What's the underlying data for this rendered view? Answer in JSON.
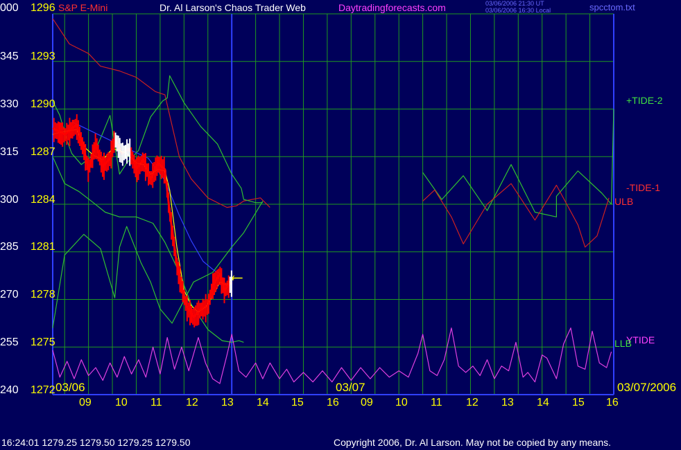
{
  "header": {
    "symbol": "S&P E-Mini",
    "title": "Dr. Al Larson's Chaos Trader Web",
    "site": "Daytradingforecasts.com",
    "timestamp_ut": "03/06/2006 21:30 UT",
    "timestamp_local": "03/06/2006 16:30 Local",
    "file": "spcctom.txt"
  },
  "footer": {
    "quote": "16:24:01  1279.25 1279.50 1279.25 1279.50",
    "copyright": "Copyright 2006, Dr. Al Larson. May not be copied by any means."
  },
  "colors": {
    "background": "#00005a",
    "grid": "#1f9a1f",
    "price_bars": "#ff0000",
    "current_bars": "#ffffff",
    "moving_average": "#ffff00",
    "upper_band": "#cc2020",
    "lower_band": "#30c030",
    "blue_curve": "#3040ff",
    "tide_oscillator": "#e040e0",
    "text_yellow": "#ffff00",
    "text_white": "#ffffff",
    "text_magenta": "#ff40ff"
  },
  "chart_data": {
    "type": "line",
    "title": "Dr. Al Larson's Chaos Trader Web",
    "price_levels": [
      1296,
      1293,
      1290,
      1287,
      1284,
      1281,
      1278,
      1275,
      1272
    ],
    "left_levels": [
      "000",
      "345",
      "330",
      "315",
      "300",
      "285",
      "270",
      "255",
      "240"
    ],
    "ylim": [
      1272,
      1296
    ],
    "x_hour_labels": [
      "09",
      "10",
      "11",
      "12",
      "13",
      "14",
      "15",
      "16",
      "09",
      "10",
      "11",
      "12",
      "13",
      "14",
      "15",
      "16"
    ],
    "date_labels": [
      "03/06",
      "03/07",
      "03/07/2006"
    ],
    "right_labels": [
      "+TIDE-2",
      "-TIDE-1",
      "ULB",
      "YTIDE",
      "LLB"
    ],
    "x_range_hours": [
      8.5,
      32
    ],
    "series": [
      {
        "name": "+TIDE-2",
        "points": [
          [
            24,
            1286
          ],
          [
            24.8,
            1284.3
          ],
          [
            25.7,
            1285.8
          ],
          [
            26.7,
            1283.6
          ],
          [
            27.7,
            1286.5
          ],
          [
            28.7,
            1283.5
          ],
          [
            29.6,
            1283.2
          ],
          [
            29.6,
            1284.5
          ],
          [
            30.5,
            1286.1
          ],
          [
            31.5,
            1284.7
          ],
          [
            31.9,
            1284
          ],
          [
            32,
            1290
          ]
        ]
      },
      {
        "name": "-TIDE-1",
        "points": [
          [
            24,
            1284.2
          ],
          [
            24.5,
            1284.9
          ],
          [
            25.2,
            1283.2
          ],
          [
            25.7,
            1281.5
          ],
          [
            26.7,
            1284
          ],
          [
            27.7,
            1285.3
          ],
          [
            28.7,
            1283
          ],
          [
            29.6,
            1285.2
          ],
          [
            30.5,
            1282.7
          ],
          [
            30.8,
            1281.3
          ],
          [
            31.3,
            1282
          ],
          [
            31.8,
            1284.4
          ]
        ]
      },
      {
        "name": "ULB",
        "points": [
          [
            8.5,
            1295.7
          ],
          [
            9.2,
            1294.1
          ],
          [
            10,
            1293.5
          ],
          [
            10.5,
            1292.7
          ],
          [
            11.3,
            1292.4
          ],
          [
            12,
            1292
          ],
          [
            12.8,
            1291.1
          ],
          [
            13.2,
            1290.9
          ],
          [
            13.8,
            1287
          ],
          [
            14.3,
            1285.6
          ],
          [
            15,
            1284.4
          ],
          [
            15.8,
            1283.8
          ],
          [
            16.2,
            1283.9
          ],
          [
            16.5,
            1284.2
          ],
          [
            17.2,
            1284.4
          ],
          [
            17.6,
            1283.8
          ]
        ]
      },
      {
        "name": "LLB",
        "points": [
          [
            8.5,
            1276.2
          ],
          [
            9,
            1280.8
          ],
          [
            9.8,
            1282.1
          ],
          [
            10.5,
            1281.2
          ],
          [
            11.1,
            1278.1
          ],
          [
            11.3,
            1281.3
          ],
          [
            11.6,
            1282.6
          ],
          [
            12.2,
            1280.3
          ],
          [
            12.6,
            1279.1
          ],
          [
            13,
            1277.4
          ],
          [
            13.5,
            1276.5
          ],
          [
            14.4,
            1279.1
          ],
          [
            15.2,
            1279.7
          ],
          [
            16,
            1281.3
          ],
          [
            16.5,
            1282.2
          ],
          [
            17.3,
            1284.2
          ]
        ]
      },
      {
        "name": "Lower envelope",
        "points": [
          [
            8.5,
            1287
          ],
          [
            9,
            1285.3
          ],
          [
            9.6,
            1284.8
          ],
          [
            10.2,
            1284.1
          ],
          [
            10.7,
            1283.5
          ],
          [
            11.3,
            1283.2
          ],
          [
            12,
            1283.2
          ],
          [
            12.7,
            1282.8
          ],
          [
            13.2,
            1281.6
          ],
          [
            13.8,
            1279.7
          ],
          [
            14.3,
            1277.7
          ],
          [
            15,
            1276.1
          ],
          [
            15.6,
            1275.4
          ],
          [
            16,
            1275.3
          ],
          [
            16.3,
            1275.4
          ],
          [
            16.5,
            1275.3
          ]
        ]
      },
      {
        "name": "Upper envelope",
        "points": [
          [
            8.5,
            1290.5
          ],
          [
            8.8,
            1289.6
          ],
          [
            9.1,
            1288
          ],
          [
            9.3,
            1287.2
          ],
          [
            9.7,
            1286.5
          ],
          [
            10.2,
            1287.1
          ],
          [
            10.6,
            1288.5
          ],
          [
            10.9,
            1289.6
          ],
          [
            11.3,
            1285.9
          ],
          [
            11.6,
            1286.6
          ],
          [
            12.1,
            1287.4
          ],
          [
            12.6,
            1289.5
          ],
          [
            13.1,
            1290.5
          ],
          [
            13.3,
            1290.7
          ],
          [
            13.4,
            1292.1
          ],
          [
            14,
            1290.4
          ],
          [
            14.7,
            1288.9
          ],
          [
            15.4,
            1287.8
          ],
          [
            16,
            1285.9
          ],
          [
            16.4,
            1285
          ],
          [
            16.5,
            1284.3
          ],
          [
            17,
            1284.1
          ],
          [
            17.3,
            1284.1
          ]
        ]
      },
      {
        "name": "Blue trend",
        "points": [
          [
            9.3,
            1289.2
          ],
          [
            10.4,
            1288.4
          ],
          [
            11.5,
            1287.6
          ],
          [
            12.5,
            1286.9
          ],
          [
            13.2,
            1285.5
          ],
          [
            13.8,
            1283.3
          ],
          [
            14.3,
            1281.7
          ],
          [
            14.8,
            1280.4
          ],
          [
            15.2,
            1279.9
          ],
          [
            15.5,
            1279.6
          ]
        ]
      },
      {
        "name": "Price",
        "points": [
          [
            8.5,
            1288.8
          ],
          [
            9,
            1288.4
          ],
          [
            9.5,
            1289
          ],
          [
            9.8,
            1287.5
          ],
          [
            10,
            1286.2
          ],
          [
            10.3,
            1287.8
          ],
          [
            10.6,
            1286.4
          ],
          [
            10.9,
            1286.9
          ],
          [
            11.1,
            1288.2
          ],
          [
            11.4,
            1287.2
          ],
          [
            11.7,
            1287.5
          ],
          [
            12,
            1286.2
          ],
          [
            12.3,
            1286.8
          ],
          [
            12.6,
            1285.6
          ],
          [
            12.9,
            1286.6
          ],
          [
            13.2,
            1286.2
          ],
          [
            13.4,
            1283.5
          ],
          [
            13.7,
            1280.2
          ],
          [
            14.1,
            1277.6
          ],
          [
            14.4,
            1276.9
          ],
          [
            14.7,
            1277.4
          ],
          [
            15,
            1277.6
          ],
          [
            15.2,
            1278.9
          ],
          [
            15.5,
            1279.6
          ],
          [
            15.7,
            1278.6
          ],
          [
            16,
            1279.1
          ]
        ]
      },
      {
        "name": "Moving average",
        "points": [
          [
            8.5,
            1288.4
          ],
          [
            9,
            1288.6
          ],
          [
            9.5,
            1288.7
          ],
          [
            9.9,
            1287.5
          ],
          [
            10.2,
            1287.1
          ],
          [
            10.6,
            1286.8
          ],
          [
            11,
            1287.5
          ],
          [
            11.3,
            1287.4
          ],
          [
            11.6,
            1287.2
          ],
          [
            12,
            1286.6
          ],
          [
            12.3,
            1286.5
          ],
          [
            12.6,
            1285.9
          ],
          [
            12.9,
            1286.2
          ],
          [
            13.2,
            1286.1
          ],
          [
            13.4,
            1284.9
          ],
          [
            13.7,
            1281.3
          ],
          [
            14,
            1278.6
          ],
          [
            14.3,
            1277.6
          ],
          [
            14.6,
            1277.2
          ],
          [
            14.9,
            1277.5
          ],
          [
            15.2,
            1278.2
          ],
          [
            15.5,
            1279.1
          ],
          [
            15.8,
            1278.9
          ],
          [
            16,
            1279.3
          ],
          [
            16.1,
            1279.5
          ]
        ]
      },
      {
        "name": "YTIDE",
        "points": [
          [
            8.5,
            1274.8
          ],
          [
            8.8,
            1273.1
          ],
          [
            9.1,
            1274.1
          ],
          [
            9.4,
            1273
          ],
          [
            9.7,
            1274.2
          ],
          [
            10,
            1273.2
          ],
          [
            10.3,
            1273.7
          ],
          [
            10.6,
            1272.9
          ],
          [
            10.9,
            1274
          ],
          [
            11.2,
            1273.1
          ],
          [
            11.5,
            1274.4
          ],
          [
            11.8,
            1273.3
          ],
          [
            12.1,
            1274.2
          ],
          [
            12.4,
            1273.1
          ],
          [
            12.7,
            1275
          ],
          [
            13,
            1273.3
          ],
          [
            13.3,
            1275.6
          ],
          [
            13.6,
            1273.6
          ],
          [
            13.9,
            1275
          ],
          [
            14.2,
            1273.5
          ],
          [
            14.6,
            1275.6
          ],
          [
            14.9,
            1274
          ],
          [
            15.2,
            1273
          ],
          [
            15.5,
            1272.7
          ],
          [
            15.8,
            1274.5
          ],
          [
            16,
            1275.8
          ],
          [
            16.3,
            1273.5
          ],
          [
            16.6,
            1273.1
          ],
          [
            17,
            1274
          ],
          [
            17.3,
            1273
          ],
          [
            17.6,
            1274
          ],
          [
            18,
            1273
          ],
          [
            18.3,
            1273.6
          ],
          [
            18.6,
            1272.8
          ],
          [
            19,
            1273.4
          ],
          [
            19.4,
            1272.8
          ],
          [
            19.8,
            1273.5
          ],
          [
            20.2,
            1272.8
          ],
          [
            20.6,
            1273.7
          ],
          [
            21,
            1272.9
          ],
          [
            21.4,
            1273.7
          ],
          [
            21.8,
            1273
          ],
          [
            22.2,
            1273.7
          ],
          [
            22.6,
            1273.1
          ],
          [
            23,
            1273.5
          ],
          [
            23.4,
            1273.1
          ],
          [
            23.8,
            1274.6
          ],
          [
            24,
            1275.8
          ],
          [
            24.3,
            1273.5
          ],
          [
            24.6,
            1273.2
          ],
          [
            24.9,
            1274.2
          ],
          [
            25.2,
            1276.2
          ],
          [
            25.5,
            1273.8
          ],
          [
            25.8,
            1273.4
          ],
          [
            26.1,
            1273.8
          ],
          [
            26.4,
            1273.2
          ],
          [
            26.7,
            1274.2
          ],
          [
            27,
            1273
          ],
          [
            27.3,
            1273.8
          ],
          [
            27.6,
            1273.5
          ],
          [
            27.9,
            1275.3
          ],
          [
            28.2,
            1273.1
          ],
          [
            28.4,
            1273.4
          ],
          [
            28.7,
            1272.8
          ],
          [
            29,
            1274.5
          ],
          [
            29.2,
            1274.3
          ],
          [
            29.6,
            1273
          ],
          [
            29.9,
            1275.2
          ],
          [
            30.2,
            1276.2
          ],
          [
            30.5,
            1273.8
          ],
          [
            30.8,
            1273.6
          ],
          [
            31.1,
            1276
          ],
          [
            31.4,
            1274
          ],
          [
            31.7,
            1273.7
          ],
          [
            31.9,
            1274.7
          ]
        ]
      }
    ]
  }
}
